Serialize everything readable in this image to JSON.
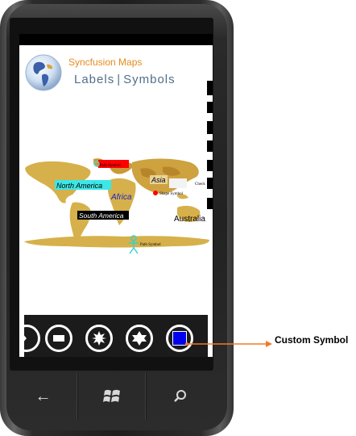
{
  "app": {
    "title": "Syncfusion Maps",
    "nav": {
      "labels": "Labels",
      "separator": "|",
      "symbols": "Symbols"
    }
  },
  "map": {
    "labels": {
      "north_america": "North America",
      "africa": "Africa",
      "south_america": "South America",
      "asia": "Asia",
      "australia": "Australia",
      "path_symbol_top": "Path Symbol",
      "shape_symbol": "Shape Symbol",
      "path_symbol_bottom": "Path Symbol",
      "check": "Check"
    },
    "colors": {
      "land": "#d6b04a",
      "land_dark": "#b8862a",
      "na_label_bg": "#3de7e7",
      "red_symbol": "#ff0000",
      "dark_label_bg": "#000000"
    }
  },
  "appbar": {
    "buttons": [
      {
        "icon": "circle-partial-icon"
      },
      {
        "icon": "rectangle-icon"
      },
      {
        "icon": "starburst-icon"
      },
      {
        "icon": "star-of-david-icon"
      },
      {
        "icon": "custom-square-icon",
        "fill": "#0000ee"
      }
    ]
  },
  "softkeys": {
    "back": "←",
    "start": "start-windows-icon",
    "search": "search-icon"
  },
  "annotation": {
    "callout": "Custom Symbol",
    "arrow_color": "#f07a2a"
  }
}
